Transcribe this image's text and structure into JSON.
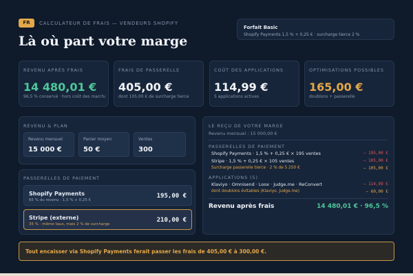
{
  "header": {
    "lang_badge": "FR",
    "subtitle": "CALCULATEUR DE FRAIS — VENDEURS SHOPIFY",
    "title": "Là où part votre marge"
  },
  "plan": {
    "name": "Forfait Basic",
    "detail": "Shopify Payments 1,5 % + 0,25 €  ·  surcharge tierce 2 %"
  },
  "kpis": [
    {
      "label": "REVENU APRÈS FRAIS",
      "value": "14 480,01 €",
      "sub": "96,5 % conservé · hors coût des marchandises",
      "color": "#4ec79a"
    },
    {
      "label": "FRAIS DE PASSERELLE",
      "value": "405,00 €",
      "sub": "dont 105,00 € de surcharge tierce",
      "color": "#f2f4f8"
    },
    {
      "label": "COÛT DES APPLICATIONS",
      "value": "114,99 €",
      "sub": "5 applications actives",
      "color": "#f2f4f8"
    },
    {
      "label": "OPTIMISATIONS POSSIBLES",
      "value": "165,00 €",
      "sub": "doublons + passerelle",
      "color": "#e5a84a"
    }
  ],
  "revenue_plan": {
    "label": "REVENU & PLAN",
    "fields": [
      {
        "label": "Revenu mensuel",
        "value": "15 000 €"
      },
      {
        "label": "Panier moyen",
        "value": "50 €"
      },
      {
        "label": "Ventes",
        "value": "300"
      }
    ]
  },
  "gateways": {
    "label": "PASSERELLES DE PAIEMENT",
    "items": [
      {
        "name": "Shopify Payments",
        "sub": "65 % du revenu  ·  1,5 % + 0,25 €",
        "amount": "195,00 €"
      },
      {
        "name": "Stripe (externe)",
        "sub": "35 %  ·  même taux, mais 2 % de surcharge",
        "amount": "210,00 €"
      }
    ]
  },
  "receipt": {
    "label": "LE REÇU DE VOTRE MARGE",
    "revenue_line": "Revenu mensuel : 15 000,00 €",
    "gateways_label": "PASSERELLES DE PAIEMENT",
    "gateway_rows": [
      {
        "label": "Shopify Payments · 1,5 % + 0,25 € × 195 ventes",
        "amount": "− 195,00 €"
      },
      {
        "label": "Stripe · 1,5 % + 0,25 € × 105 ventes",
        "amount": "− 105,00 €"
      },
      {
        "label": "Surcharge passerelle tierce · 2 % de 5 250 €",
        "amount": "− 105,00 €"
      }
    ],
    "apps_label": "APPLICATIONS (5)",
    "app_rows": [
      {
        "label": "Klaviyo · Omnisend · Loox · Judge.me · ReConvert",
        "amount": "− 114,99 €"
      },
      {
        "label": "dont doublons évitables (Klaviyo, Judge.me)",
        "amount": "− 60,00 €"
      }
    ],
    "net_label": "Revenu après frais",
    "net_value": "14 480,01 €  ·  96,5 %"
  },
  "tip": {
    "text": "Tout encaisser via Shopify Payments ferait passer les frais de 405,00 € à 300,00 €."
  },
  "colors": {
    "background": "#0f1a2b",
    "card": "#17253a",
    "accent_gold": "#e5a84a",
    "positive_green": "#4ec79a",
    "negative_red": "#e05a5a"
  }
}
